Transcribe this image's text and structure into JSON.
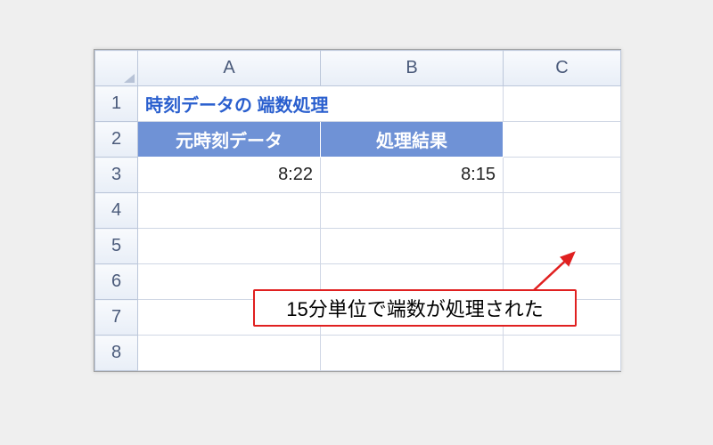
{
  "columns": {
    "A": "A",
    "B": "B",
    "C": "C"
  },
  "rows": [
    "1",
    "2",
    "3",
    "4",
    "5",
    "6",
    "7",
    "8"
  ],
  "cells": {
    "A1": "時刻データの 端数処理",
    "A2": "元時刻データ",
    "B2": "処理結果",
    "A3": "8:22",
    "B3": "8:15"
  },
  "callout": "15分単位で端数が処理された",
  "colors": {
    "band_bg": "#6f92d6",
    "title_fg": "#2a5fce",
    "callout_border": "#e02020"
  }
}
